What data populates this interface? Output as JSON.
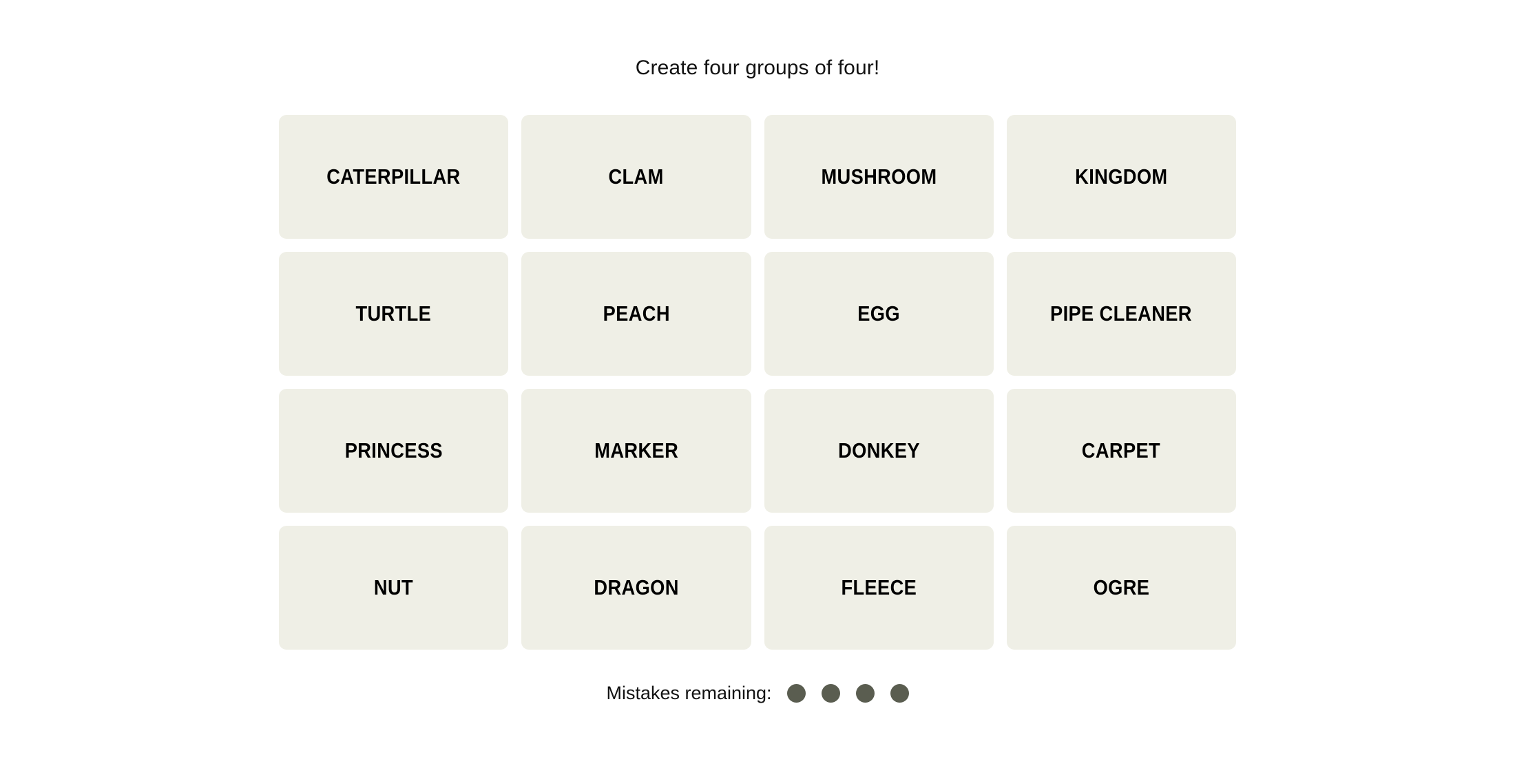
{
  "game": {
    "title": "Create four groups of four!",
    "board": {
      "rows": [
        [
          {
            "word": "CATERPILLAR"
          },
          {
            "word": "CLAM"
          },
          {
            "word": "MUSHROOM"
          },
          {
            "word": "KINGDOM"
          }
        ],
        [
          {
            "word": "TURTLE"
          },
          {
            "word": "PEACH"
          },
          {
            "word": "EGG"
          },
          {
            "word": "PIPE CLEANER"
          }
        ],
        [
          {
            "word": "PRINCESS"
          },
          {
            "word": "MARKER"
          },
          {
            "word": "DONKEY"
          },
          {
            "word": "CARPET"
          }
        ],
        [
          {
            "word": "NUT"
          },
          {
            "word": "DRAGON"
          },
          {
            "word": "FLEECE"
          },
          {
            "word": "OGRE"
          }
        ]
      ]
    },
    "mistakes": {
      "label": "Mistakes remaining:",
      "remaining": 4,
      "dots": [
        {
          "state": "filled"
        },
        {
          "state": "filled"
        },
        {
          "state": "filled"
        },
        {
          "state": "filled"
        }
      ]
    }
  },
  "colors": {
    "page_background": "#ffffff",
    "tile_background": "#efefe6",
    "tile_text": "#000000",
    "title_text": "#121212",
    "mistake_dot": "#5a5d50"
  }
}
